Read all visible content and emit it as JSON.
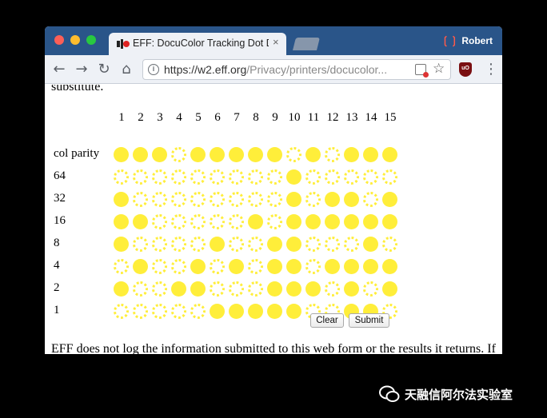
{
  "browser": {
    "tab_title": "EFF: DocuColor Tracking Dot D",
    "tab_close": "×",
    "profile_name": "Robert",
    "url_host": "https://w2.eff.org",
    "url_path": "/Privacy/printers/docucolor..."
  },
  "page": {
    "top_text": "substitute.",
    "columns": [
      "1",
      "2",
      "3",
      "4",
      "5",
      "6",
      "7",
      "8",
      "9",
      "10",
      "11",
      "12",
      "13",
      "14",
      "15"
    ],
    "rows": [
      {
        "label": "col parity",
        "dots": [
          1,
          1,
          1,
          0,
          1,
          1,
          1,
          1,
          1,
          0,
          1,
          0,
          1,
          1,
          1
        ]
      },
      {
        "label": "64",
        "dots": [
          0,
          0,
          0,
          0,
          0,
          0,
          0,
          0,
          0,
          1,
          0,
          0,
          0,
          0,
          0
        ]
      },
      {
        "label": "32",
        "dots": [
          1,
          0,
          0,
          0,
          0,
          0,
          0,
          0,
          0,
          1,
          0,
          1,
          1,
          0,
          1
        ]
      },
      {
        "label": "16",
        "dots": [
          1,
          1,
          0,
          0,
          0,
          0,
          0,
          1,
          0,
          1,
          1,
          1,
          1,
          1,
          1
        ]
      },
      {
        "label": "8",
        "dots": [
          1,
          0,
          0,
          0,
          0,
          1,
          0,
          0,
          1,
          1,
          0,
          0,
          0,
          1,
          0
        ]
      },
      {
        "label": "4",
        "dots": [
          0,
          1,
          0,
          0,
          1,
          0,
          1,
          0,
          1,
          1,
          0,
          1,
          1,
          1,
          1
        ]
      },
      {
        "label": "2",
        "dots": [
          1,
          0,
          0,
          1,
          1,
          0,
          0,
          0,
          1,
          1,
          1,
          0,
          1,
          0,
          1
        ]
      },
      {
        "label": "1",
        "dots": [
          0,
          0,
          0,
          0,
          0,
          1,
          1,
          1,
          1,
          1,
          0,
          0,
          1,
          1,
          0
        ]
      }
    ],
    "clear_label": "Clear",
    "submit_label": "Submit",
    "footer_text": "EFF does not log the information submitted to this web form or the results it returns. If"
  },
  "watermark": {
    "text": "天融信阿尔法实验室"
  },
  "colors": {
    "dot": "#ffee3a",
    "titlebar": "#2a5589"
  }
}
